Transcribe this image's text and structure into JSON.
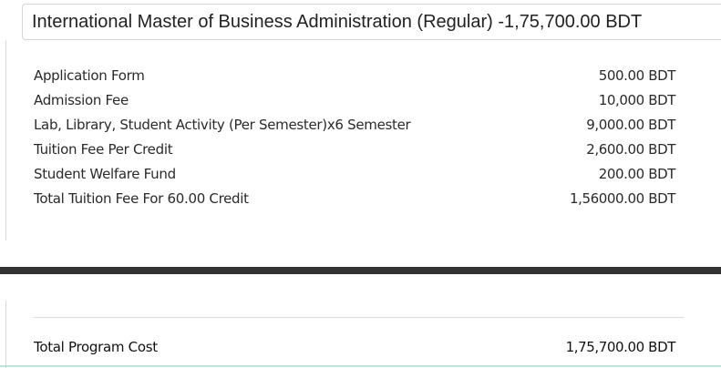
{
  "program": {
    "title": "International Master of Business Administration (Regular) -1,75,700.00 BDT"
  },
  "fees": [
    {
      "label": "Application Form",
      "amount": "500.00 BDT"
    },
    {
      "label": "Admission Fee",
      "amount": "10,000 BDT"
    },
    {
      "label": "Lab, Library, Student Activity (Per Semester)x6 Semester",
      "amount": "9,000.00 BDT"
    },
    {
      "label": "Tuition Fee Per Credit",
      "amount": "2,600.00 BDT"
    },
    {
      "label": "Student Welfare Fund",
      "amount": "200.00 BDT"
    },
    {
      "label": "Total Tuition Fee For 60.00 Credit",
      "amount": "1,56000.00 BDT"
    }
  ],
  "total": {
    "label": "Total Program Cost",
    "amount": "1,75,700.00 BDT"
  }
}
